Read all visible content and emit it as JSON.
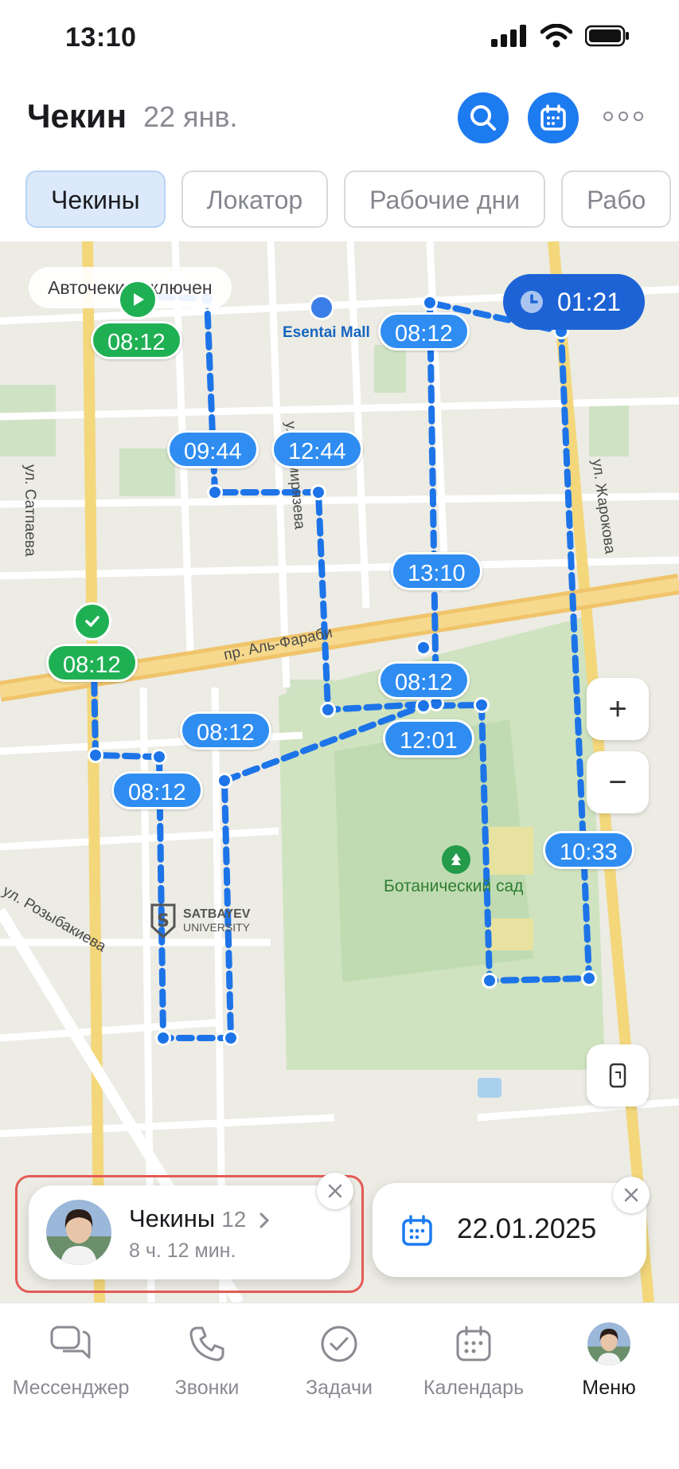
{
  "status_bar": {
    "time": "13:10"
  },
  "header": {
    "title": "Чекин",
    "date": "22 янв."
  },
  "tabs": [
    {
      "label": "Чекины",
      "active": true
    },
    {
      "label": "Локатор",
      "active": false
    },
    {
      "label": "Рабочие дни",
      "active": false
    },
    {
      "label": "Рабо",
      "active": false
    }
  ],
  "map": {
    "autocheck_label": "Авточекин включен",
    "timer": "01:21",
    "streets": {
      "satpaeva": "ул. Сатпаева",
      "timiryazeva": "ул. Тимирязева",
      "zharokova": "ул. Жарокова",
      "al_farabi": "пр. Аль-Фараби",
      "rozybakieva": "ул. Розыбакиева"
    },
    "poi": {
      "mall": "Esentai Mall",
      "garden": "Ботанический сад",
      "university_line1": "SATBAYEV",
      "university_line2": "UNIVERSITY"
    },
    "chips": {
      "start": "08:12",
      "c1": "09:44",
      "c2": "12:44",
      "c3": "08:12",
      "c4": "13:10",
      "checked": "08:12",
      "c6": "08:12",
      "c7": "08:12",
      "c8": "12:01",
      "c9": "08:12",
      "c10": "10:33"
    },
    "controls": {
      "zoom_in": "+",
      "zoom_out": "−"
    }
  },
  "checkins_card": {
    "title": "Чекины",
    "count": "12",
    "duration": "8 ч. 12 мин."
  },
  "date_card": {
    "date": "22.01.2025"
  },
  "bottom_nav": [
    {
      "label": "Мессенджер",
      "icon": "chat-icon",
      "active": false
    },
    {
      "label": "Звонки",
      "icon": "phone-icon",
      "active": false
    },
    {
      "label": "Задачи",
      "icon": "check-circle-icon",
      "active": false
    },
    {
      "label": "Календарь",
      "icon": "calendar-icon",
      "active": false
    },
    {
      "label": "Меню",
      "icon": "avatar",
      "active": true
    }
  ],
  "colors": {
    "accent": "#1d7bf0",
    "route": "#1d74e8",
    "start_green": "#20b054",
    "highlight": "#e45b55"
  }
}
